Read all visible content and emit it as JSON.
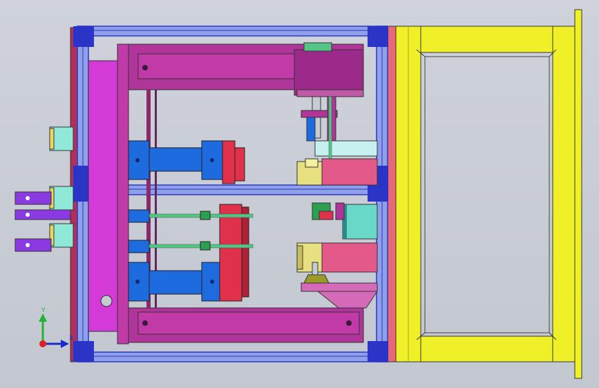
{
  "viewport": {
    "background": "#c7cbd4"
  },
  "triad": {
    "y_label": "Y",
    "x_label": "X",
    "colors": {
      "x": "#1a2ccc",
      "y": "#22b336",
      "origin": "#e02020"
    }
  },
  "palette": {
    "frame_blue": "#2a35c8",
    "frame_light": "#8fa0e8",
    "magenta": "#b0359a",
    "bright_magenta": "#d43ad8",
    "pink": "#e35a8a",
    "red": "#e0304a",
    "yellow": "#f0f028",
    "cyan": "#8fe8d8",
    "teal": "#2a8a8a",
    "green": "#2aa050",
    "cylinder_blue": "#1e6be0",
    "rod_green": "#56c486",
    "olive": "#9b9b2a",
    "purple": "#8a3ae0"
  }
}
